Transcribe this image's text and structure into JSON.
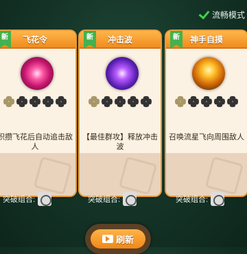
{
  "header": {
    "fast_mode_label": "流畅模式"
  },
  "cards": [
    {
      "badge": "新",
      "name": "飞花令",
      "orb_icon": "pink-energy-orb-icon",
      "level": 0,
      "max_level": 5,
      "description": "积攒飞花后自动追击敌人",
      "combo_label": "突破组合:"
    },
    {
      "badge": "新",
      "name": "冲击波",
      "orb_icon": "purple-shockwave-orb-icon",
      "level": 0,
      "max_level": 5,
      "description": "【最佳群攻】释放冲击波",
      "combo_label": "突破组合:"
    },
    {
      "badge": "新",
      "name": "神手自摸",
      "orb_icon": "golden-hand-orb-icon",
      "level": 0,
      "max_level": 5,
      "description": "召唤流星飞向周围敌人",
      "combo_label": "突破组合:"
    }
  ],
  "refresh": {
    "label": "刷新",
    "icon": "video-icon"
  },
  "colors": {
    "card_header": "#f08c1f",
    "badge_green": "#43b24d",
    "background": "#143326"
  }
}
